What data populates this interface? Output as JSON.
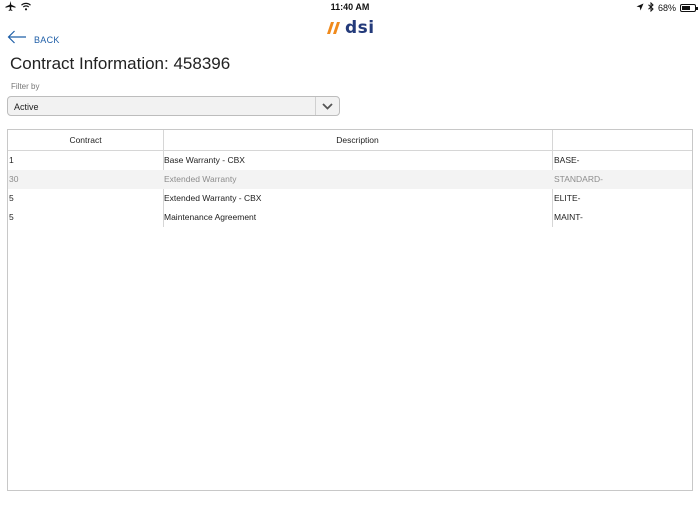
{
  "status_bar": {
    "time": "11:40 AM",
    "battery": "68%",
    "battery_level": 0.68
  },
  "logo": {
    "text": "dsi"
  },
  "nav": {
    "back_label": "BACK"
  },
  "page": {
    "title": "Contract Information: 458396"
  },
  "filter": {
    "label": "Filter by",
    "selected": "Active"
  },
  "table": {
    "headers": [
      "Contract",
      "Description",
      ""
    ],
    "rows": [
      {
        "contract": "1",
        "description": "Base Warranty - CBX",
        "code": "BASE-",
        "muted": false
      },
      {
        "contract": "30",
        "description": "Extended Warranty",
        "code": "STANDARD-",
        "muted": true
      },
      {
        "contract": "5",
        "description": "Extended Warranty - CBX",
        "code": "ELITE-",
        "muted": false
      },
      {
        "contract": "5",
        "description": "Maintenance Agreement",
        "code": "MAINT-",
        "muted": false
      }
    ]
  },
  "colors": {
    "accent": "#1f5fa8",
    "logo_orange": "#f08a1c",
    "logo_navy": "#233a7a"
  },
  "icons": [
    "airplane-icon",
    "wifi-icon",
    "location-icon",
    "bluetooth-icon",
    "battery-icon",
    "back-arrow-icon",
    "chevron-down-icon"
  ]
}
